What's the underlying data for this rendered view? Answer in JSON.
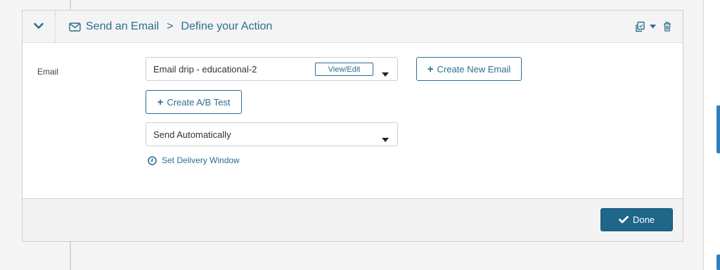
{
  "header": {
    "crumb_1": "Send an Email",
    "crumb_separator": ">",
    "crumb_2": "Define your Action",
    "icons": [
      "chevron-down-icon",
      "mail-icon",
      "copy-icon",
      "caret-down-icon",
      "trash-icon"
    ]
  },
  "form": {
    "email_label": "Email",
    "email_select_value": "Email drip - educational-2",
    "view_edit_label": "View/Edit",
    "create_new_email_label": "Create New Email",
    "create_ab_test_label": "Create A/B Test",
    "send_select_value": "Send Automatically",
    "delivery_window_label": "Set Delivery Window"
  },
  "footer": {
    "done_label": "Done"
  },
  "colors": {
    "accent": "#2a6f8e",
    "done_button": "#1f6688",
    "header_bg": "#f4f4f4",
    "scroll_accent": "#2f80c1"
  }
}
